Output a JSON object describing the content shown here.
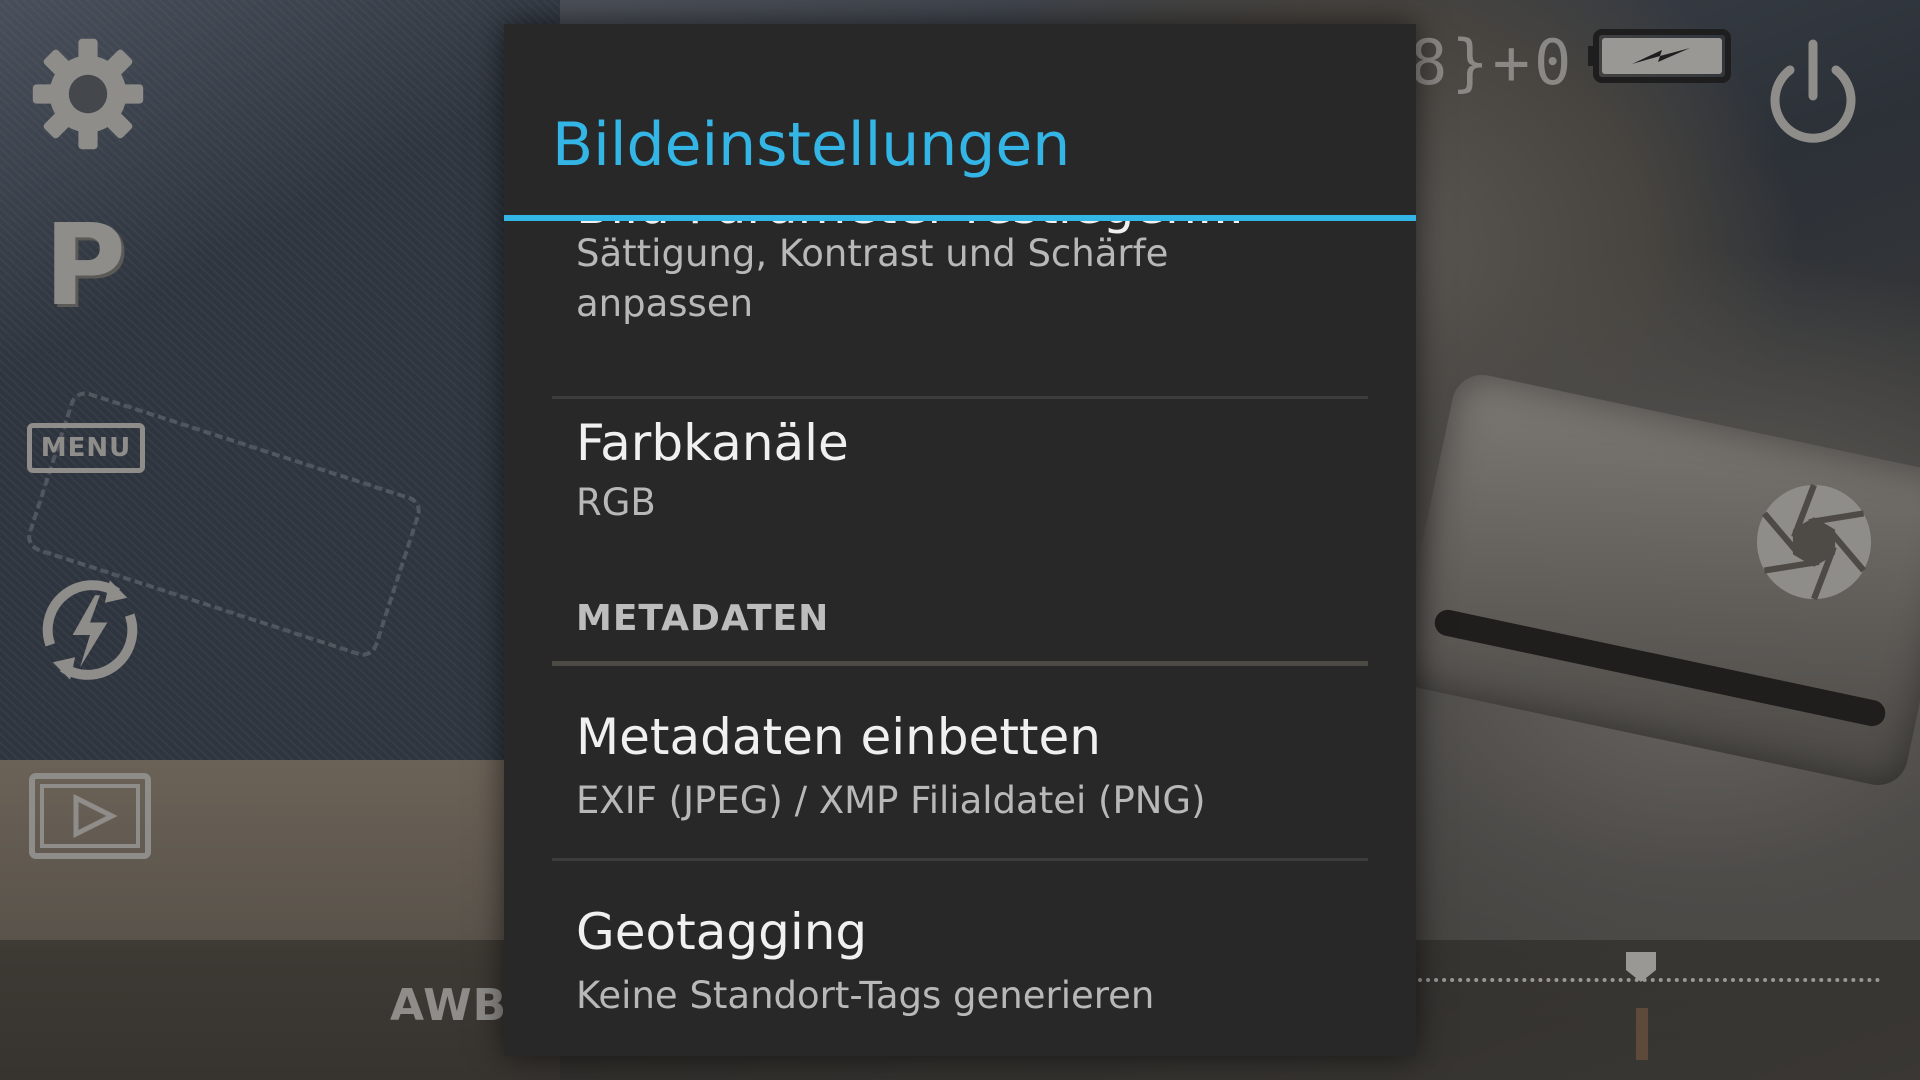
{
  "camera": {
    "mode": "P",
    "menu_label": "MENU",
    "white_balance": "AWB",
    "exposure_readout": "8}+0",
    "exposure_slider_value": 0
  },
  "dialog": {
    "title": "Bildeinstellungen",
    "items": [
      {
        "title": "Bild-Parameter festlegen...",
        "summary_line1": "Sättigung, Kontrast und Schärfe",
        "summary_line2": "anpassen"
      },
      {
        "title": "Farbkanäle",
        "summary": "RGB"
      }
    ],
    "category": "METADATEN",
    "meta_items": [
      {
        "title": "Metadaten einbetten",
        "summary": "EXIF (JPEG) / XMP Filialdatei (PNG)"
      },
      {
        "title": "Geotagging",
        "summary": "Keine Standort-Tags generieren"
      }
    ]
  },
  "colors": {
    "accent": "#33b5e5",
    "dialog_bg": "#282828",
    "control_gray": "#8f8d8a"
  },
  "icons": [
    "gear-icon",
    "flash-auto-icon",
    "playback-icon",
    "battery-charging-icon",
    "power-icon",
    "shutter-aperture-icon"
  ]
}
